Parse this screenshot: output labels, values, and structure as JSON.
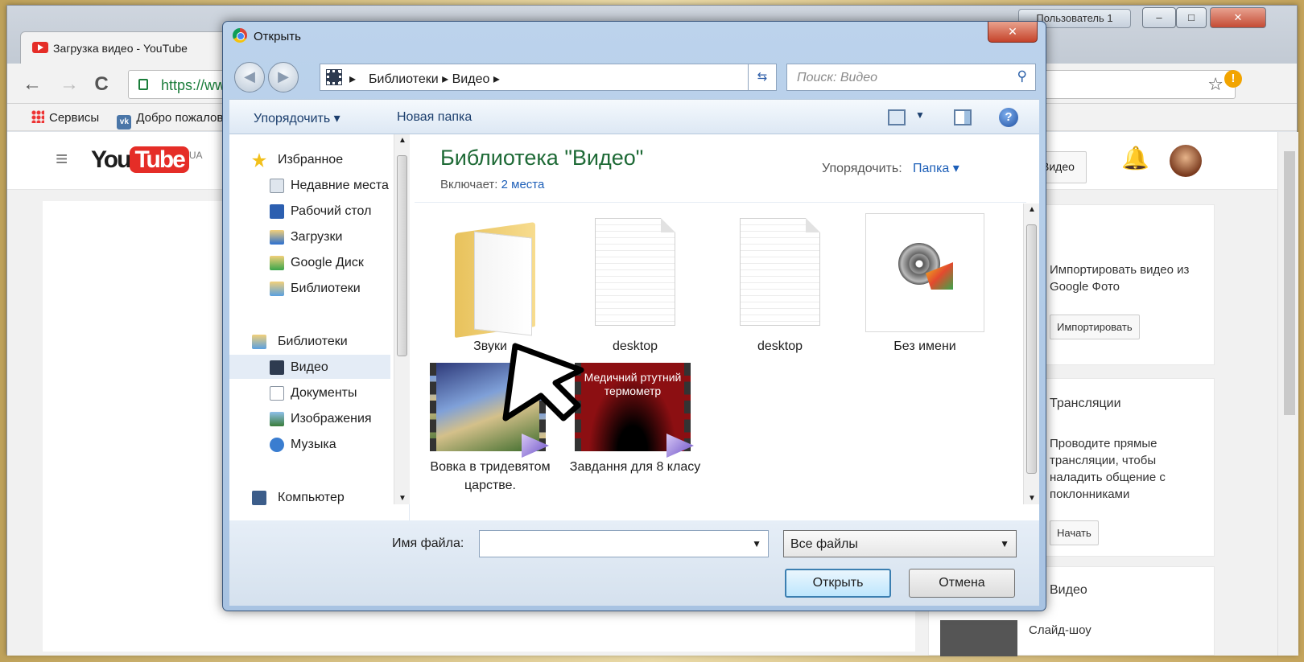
{
  "browser": {
    "user_label": "Пользователь 1",
    "window_buttons": {
      "minimize": "–",
      "maximize": "□",
      "close": "✕"
    },
    "tab": {
      "title": "Загрузка видео - YouTube"
    },
    "nav": {
      "back": "←",
      "forward": "→",
      "reload": "C"
    },
    "address": "https://www.youtube.com/upload",
    "bookmarks": [
      {
        "label": "Сервисы"
      },
      {
        "label": "Добро пожаловать"
      }
    ],
    "star": "☆",
    "warn": "!"
  },
  "youtube": {
    "logo_you": "You",
    "logo_tube": "Tube",
    "region": "UA",
    "menu": "≡",
    "header_btn": "Видео",
    "side": {
      "import_text": "Импортировать видео из Google Фото",
      "import_btn": "Импортировать",
      "live_title": "Трансляции",
      "live_text": "Проводите прямые трансляции, чтобы наладить общение с поклонниками",
      "live_btn": "Начать",
      "create_title": "Видео",
      "slideshow": "Слайд-шоу"
    }
  },
  "dialog": {
    "title": "Открыть",
    "close": "✕",
    "breadcrumb": [
      "Библиотеки",
      "Видео"
    ],
    "search_placeholder": "Поиск: Видео",
    "toolbar": {
      "organize": "Упорядочить ▾",
      "new_folder": "Новая папка",
      "help": "?"
    },
    "nav": {
      "favorites": "Избранное",
      "fav_items": [
        "Недавние места",
        "Рабочий стол",
        "Загрузки",
        "Google Диск",
        "Библиотеки"
      ],
      "libraries": "Библиотеки",
      "lib_items": [
        "Видео",
        "Документы",
        "Изображения",
        "Музыка"
      ],
      "computer": "Компьютер"
    },
    "library": {
      "heading": "Библиотека \"Видео\"",
      "includes_label": "Включает:",
      "includes_link": "2 места",
      "arrange_label": "Упорядочить:",
      "arrange_value": "Папка ▾"
    },
    "files": [
      {
        "name": "Звуки",
        "icon": "folder-icon"
      },
      {
        "name": "desktop",
        "icon": "document-icon"
      },
      {
        "name": "desktop",
        "icon": "document-icon"
      },
      {
        "name": "Без имени",
        "icon": "media-file-icon"
      },
      {
        "name": "Вовка в тридевятом царстве.",
        "icon": "video-thumbnail"
      },
      {
        "name": "Завдання для 8 класу",
        "icon": "video-thumbnail",
        "overlay": "Медичний ртутний термометр"
      }
    ],
    "footer": {
      "filename_label": "Имя файла:",
      "filename_value": "",
      "filetype": "Все файлы",
      "open_btn": "Открыть",
      "cancel_btn": "Отмена"
    }
  }
}
